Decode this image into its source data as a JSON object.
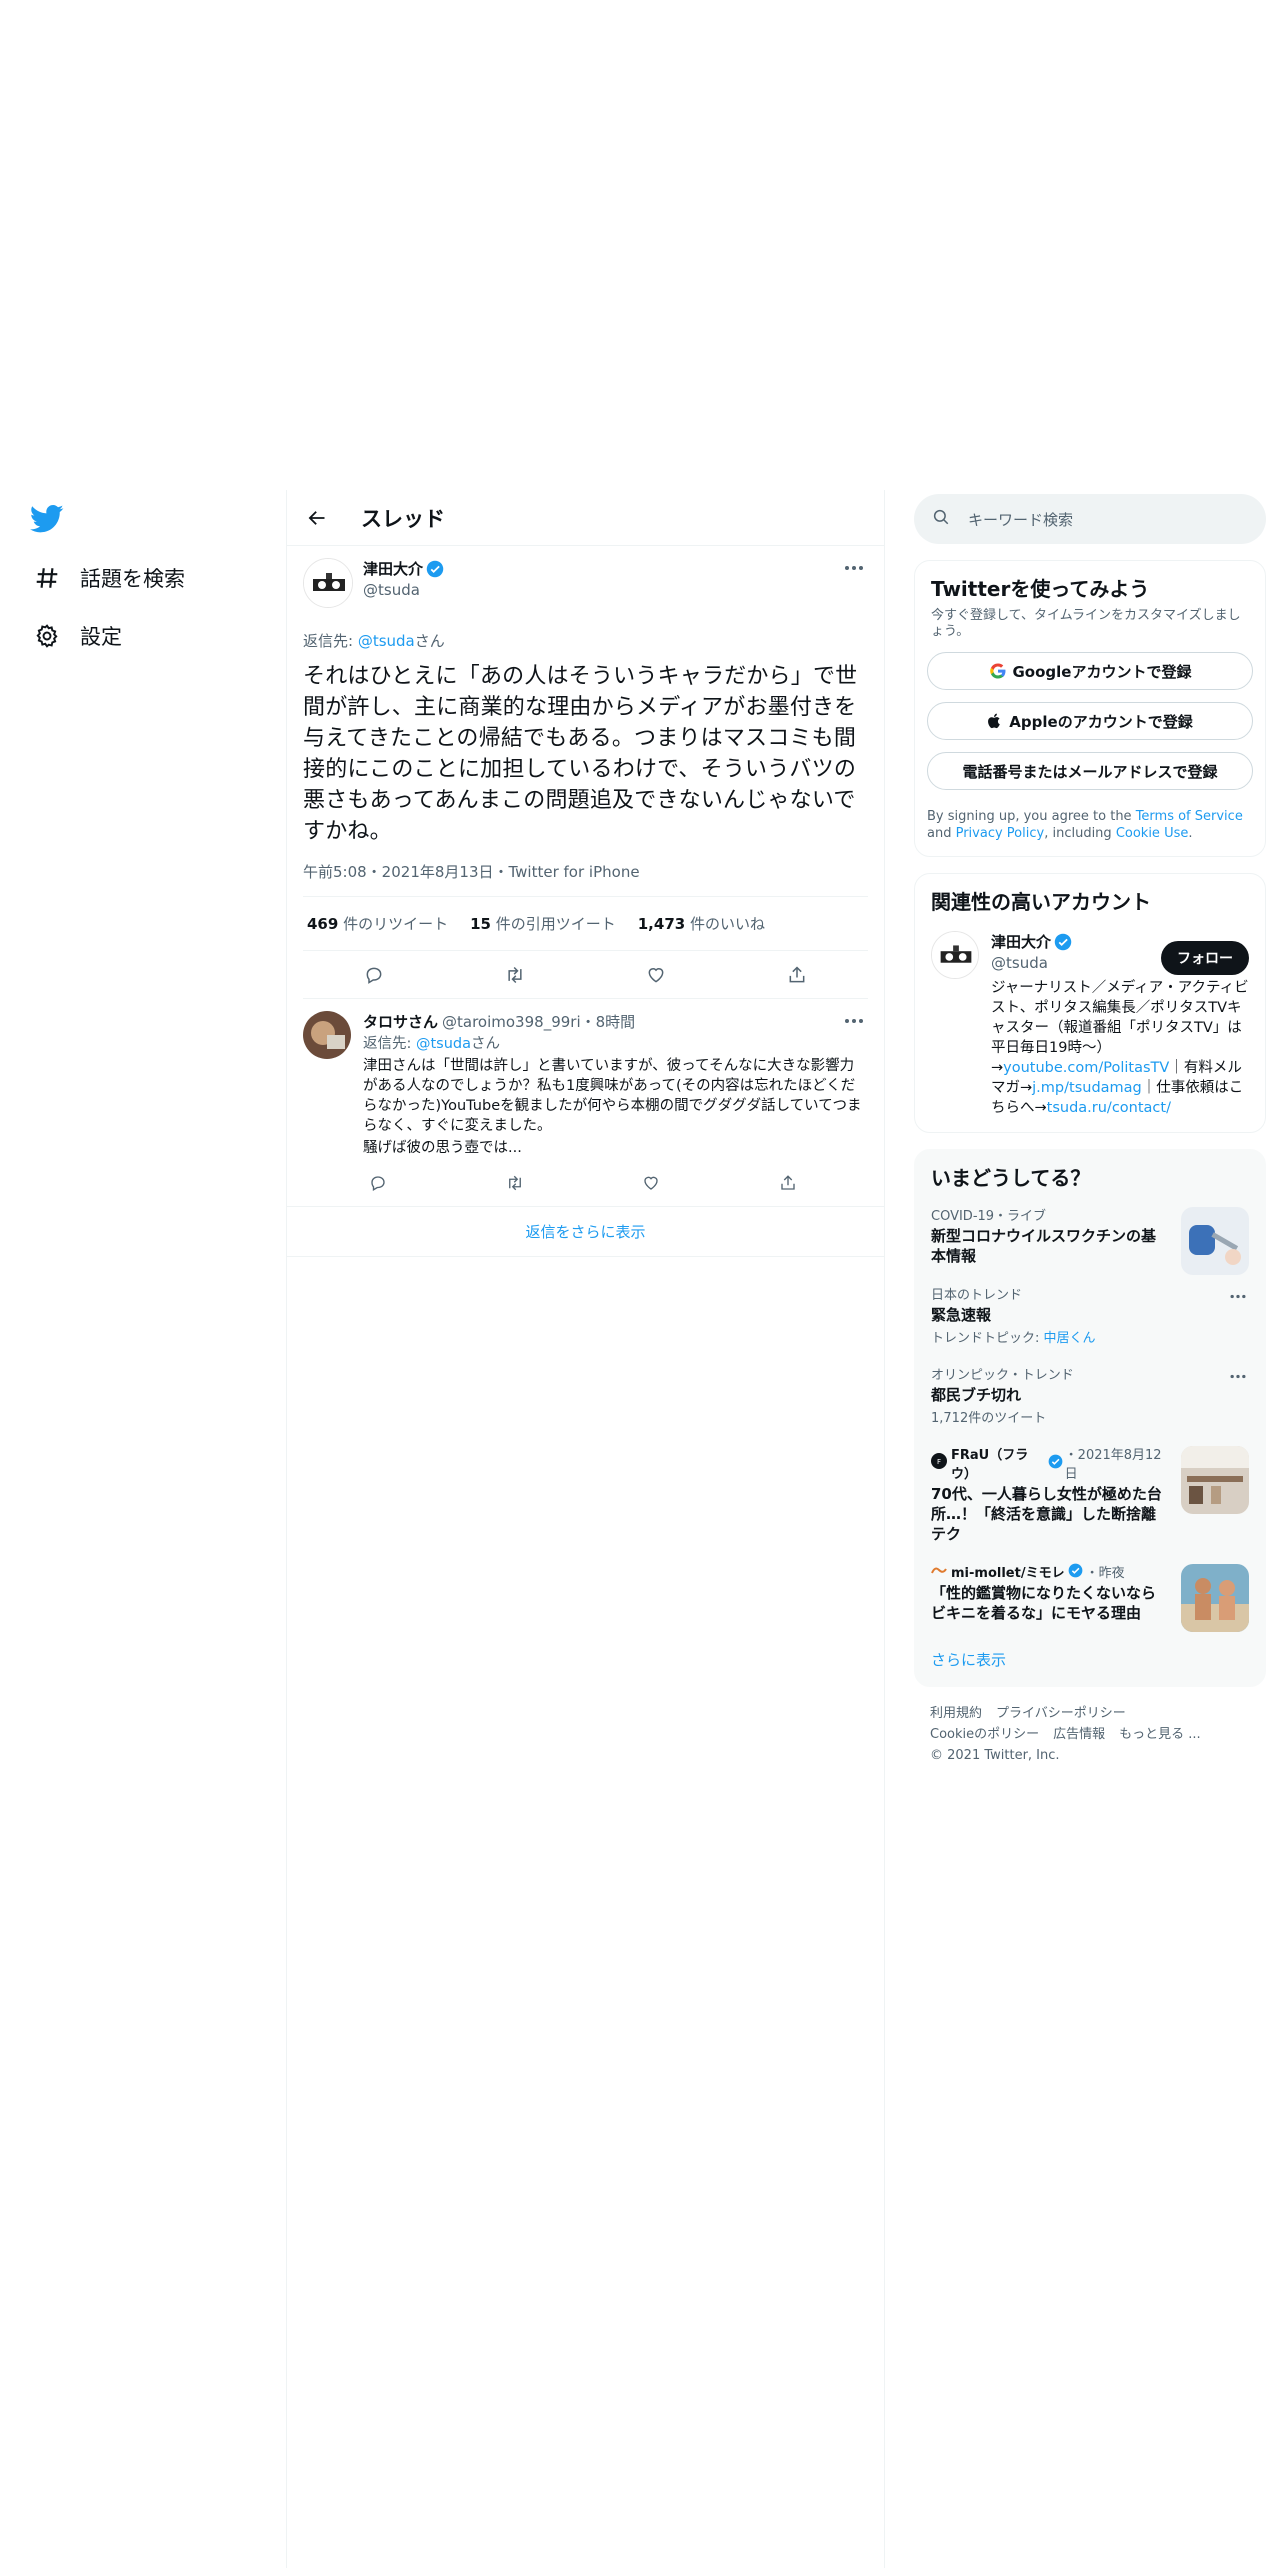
{
  "nav": {
    "explore_label": "話題を検索",
    "settings_label": "設定"
  },
  "thread": {
    "title": "スレッド",
    "main": {
      "name": "津田大介",
      "handle": "@tsuda",
      "reply_prefix": "返信先: ",
      "reply_handle": "@tsuda",
      "reply_suffix": "さん",
      "text": "それはひとえに「あの人はそういうキャラだから」で世間が許し、主に商業的な理由からメディアがお墨付きを与えてきたことの帰結でもある。つまりはマスコミも間接的にこのことに加担しているわけで、そういうバツの悪さもあってあんまこの問題追及できないんじゃないですかね。",
      "meta": "午前5:08・2021年8月13日・Twitter for iPhone",
      "retweets_count": "469",
      "retweets_label": " 件のリツイート",
      "quotes_count": "15",
      "quotes_label": " 件の引用ツイート",
      "likes_count": "1,473",
      "likes_label": " 件のいいね"
    },
    "reply": {
      "name": "タロサさん",
      "handle_time": "@taroimo398_99ri・8時間",
      "reply_prefix": "返信先: ",
      "reply_handle": "@tsuda",
      "reply_suffix": "さん",
      "text1": "津田さんは「世間は許し」と書いていますが、彼ってそんなに大きな影響力がある人なのでしょうか？私も1度興味があって(その内容は忘れたほどくだらなかった)YouTubeを観ましたが何やら本棚の間でグダグダ話していてつまらなく、すぐに変えました。",
      "text2": "騒げば彼の思う壺では..."
    },
    "show_more": "返信をさらに表示"
  },
  "sidebar": {
    "search_placeholder": "キーワード検索",
    "signup": {
      "title": "Twitterを使ってみよう",
      "subtitle": "今すぐ登録して、タイムラインをカスタマイズしましょう。",
      "google": "Googleアカウントで登録",
      "apple": "Appleのアカウントで登録",
      "phone": "電話番号またはメールアドレスで登録",
      "legal_1": "By signing up, you agree to the ",
      "legal_tos": "Terms of Service",
      "legal_2": " and ",
      "legal_privacy": "Privacy Policy",
      "legal_3": ", including ",
      "legal_cookie": "Cookie Use",
      "legal_4": "."
    },
    "related": {
      "title": "関連性の高いアカウント",
      "name": "津田大介",
      "handle": "@tsuda",
      "follow": "フォロー",
      "bio_1": "ジャーナリスト／メディア・アクティビスト、ポリタス編集長／ポリタスTVキャスター（報道番組「ポリタスTV」は平日毎日19時～）→",
      "bio_link1": "youtube.com/PolitasTV",
      "bio_2": "｜有料メルマガ→",
      "bio_link2": "j.mp/tsudamag",
      "bio_3": "｜仕事依頼はこちらへ→",
      "bio_link3": "tsuda.ru/contact/"
    },
    "trends": {
      "title": "いまどうしてる？",
      "items": [
        {
          "category": "COVID-19・ライブ",
          "title": "新型コロナウイルスワクチンの基本情報"
        },
        {
          "category": "日本のトレンド",
          "title": "緊急速報",
          "sub_prefix": "トレンドトピック: ",
          "sub_link": "中居くん"
        },
        {
          "category": "オリンピック・トレンド",
          "title": "都民ブチ切れ",
          "sub": "1,712件のツイート"
        },
        {
          "source": "FRaU（フラウ）",
          "time": "・2021年8月12日",
          "title": "70代、一人暮らし女性が極めた台所…！「終活を意識」した断捨離テク"
        },
        {
          "source": "mi-mollet/ミモレ",
          "time": "・昨夜",
          "title": "「性的鑑賞物になりたくないならビキニを着るな」にモヤる理由"
        }
      ],
      "more": "さらに表示"
    },
    "footer": {
      "terms": "利用規約",
      "privacy": "プライバシーポリシー",
      "cookie": "Cookieのポリシー",
      "ads": "広告情報",
      "more": "もっと見る ...",
      "copyright": "© 2021 Twitter, Inc."
    }
  },
  "colors": {
    "accent": "#1d9bf0",
    "text": "#0f1419",
    "secondary": "#536471",
    "border": "#eff3f4"
  }
}
